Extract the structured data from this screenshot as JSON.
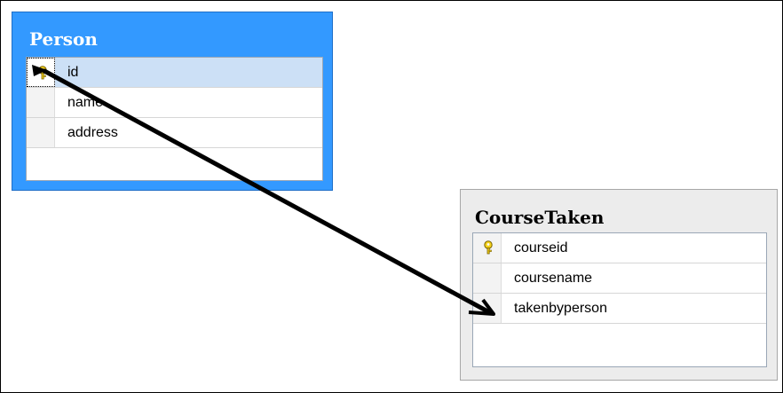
{
  "tables": [
    {
      "title": "Person",
      "columns": [
        {
          "name": "id",
          "primary_key": true,
          "selected": true
        },
        {
          "name": "name",
          "primary_key": false,
          "selected": false
        },
        {
          "name": "address",
          "primary_key": false,
          "selected": false
        }
      ]
    },
    {
      "title": "CourseTaken",
      "columns": [
        {
          "name": "courseid",
          "primary_key": true,
          "selected": false
        },
        {
          "name": "coursename",
          "primary_key": false,
          "selected": false
        },
        {
          "name": "takenbyperson",
          "primary_key": false,
          "selected": false
        }
      ]
    }
  ],
  "colors": {
    "person_header": "#3399ff",
    "course_header": "#ececec",
    "key_icon": "#f4d21a",
    "relation_line": "#000000"
  },
  "icons": {
    "primary_key": "key-icon",
    "relation": "relationship-arrow"
  }
}
